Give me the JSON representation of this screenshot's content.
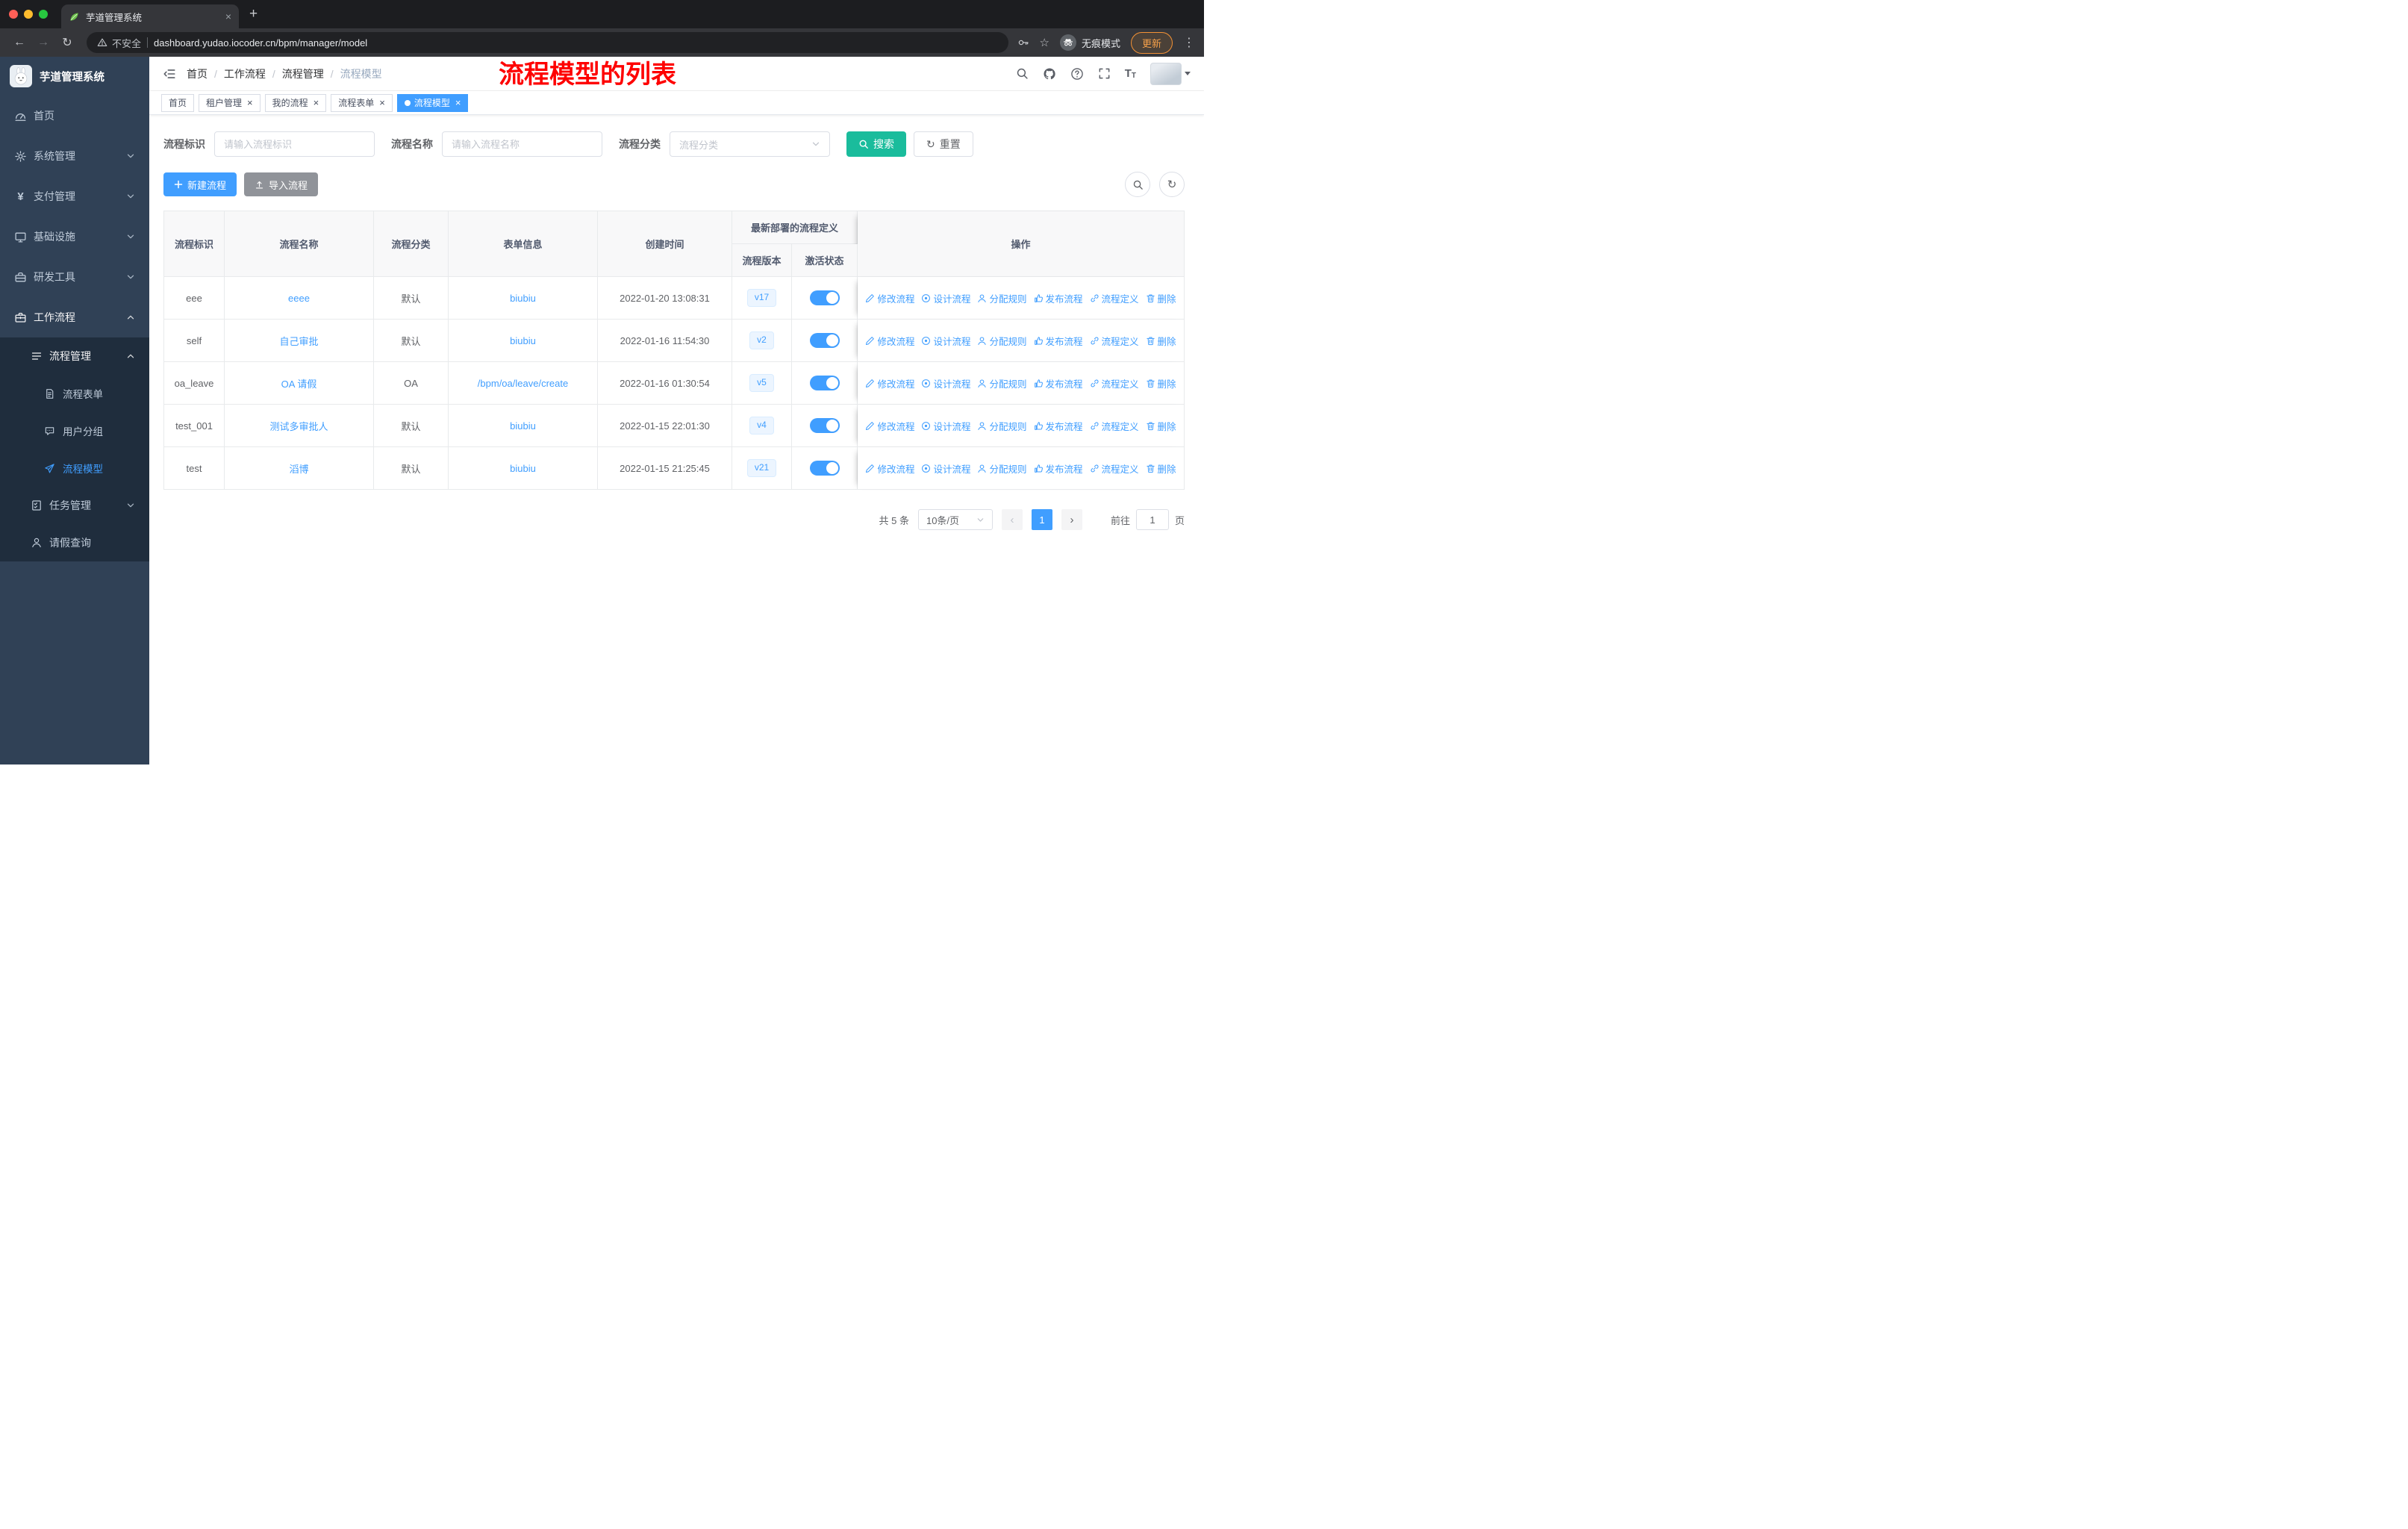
{
  "browser": {
    "tab_title": "芋道管理系统",
    "security_label": "不安全",
    "url": "dashboard.yudao.iocoder.cn/bpm/manager/model",
    "incognito_label": "无痕模式",
    "update_label": "更新"
  },
  "glyphs": {
    "close": "×",
    "new_tab": "+",
    "back": "←",
    "forward": "→",
    "reload": "↻",
    "star": "☆",
    "dots": "⋮",
    "prev": "‹",
    "next": "›",
    "refresh": "↻",
    "font_big": "T",
    "font_small": "T",
    "yen": "¥"
  },
  "sidebar": {
    "logo_title": "芋道管理系统",
    "menu": [
      {
        "label": "首页",
        "icon": "dashboard-icon"
      },
      {
        "label": "系统管理",
        "icon": "gear-icon"
      },
      {
        "label": "支付管理",
        "icon": "yen-icon"
      },
      {
        "label": "基础设施",
        "icon": "monitor-icon"
      },
      {
        "label": "研发工具",
        "icon": "toolbox-icon"
      },
      {
        "label": "工作流程",
        "icon": "briefcase-icon"
      },
      {
        "label": "流程管理",
        "icon": "list-icon"
      },
      {
        "label": "流程表单",
        "icon": "document-icon"
      },
      {
        "label": "用户分组",
        "icon": "chat-icon"
      },
      {
        "label": "流程模型",
        "icon": "paper-plane-icon"
      },
      {
        "label": "任务管理",
        "icon": "checklist-icon"
      },
      {
        "label": "请假查询",
        "icon": "user-icon"
      }
    ]
  },
  "navbar": {
    "breadcrumb": [
      "首页",
      "工作流程",
      "流程管理",
      "流程模型"
    ],
    "separator": "/"
  },
  "annotation": {
    "text": "流程模型的列表",
    "color": "#FE0000"
  },
  "tags": [
    {
      "label": "首页",
      "closable": false,
      "active": false
    },
    {
      "label": "租户管理",
      "closable": true,
      "active": false
    },
    {
      "label": "我的流程",
      "closable": true,
      "active": false
    },
    {
      "label": "流程表单",
      "closable": true,
      "active": false
    },
    {
      "label": "流程模型",
      "closable": true,
      "active": true
    }
  ],
  "filters": {
    "key_label": "流程标识",
    "key_placeholder": "请输入流程标识",
    "name_label": "流程名称",
    "name_placeholder": "请输入流程名称",
    "category_label": "流程分类",
    "category_placeholder": "流程分类",
    "search_label": "搜索",
    "reset_label": "重置"
  },
  "toolbar": {
    "create_label": "新建流程",
    "import_label": "导入流程"
  },
  "table": {
    "columns": [
      "流程标识",
      "流程名称",
      "流程分类",
      "表单信息",
      "创建时间",
      "流程版本",
      "激活状态",
      "操作"
    ],
    "group_header": "最新部署的流程定义",
    "row_actions": [
      {
        "icon": "edit-icon",
        "label": "修改流程"
      },
      {
        "icon": "design-icon",
        "label": "设计流程"
      },
      {
        "icon": "assign-icon",
        "label": "分配规则"
      },
      {
        "icon": "publish-icon",
        "label": "发布流程"
      },
      {
        "icon": "definition-icon",
        "label": "流程定义"
      },
      {
        "icon": "delete-icon",
        "label": "删除"
      }
    ],
    "rows": [
      {
        "key": "eee",
        "name": "eeee",
        "category": "默认",
        "form": "biubiu",
        "created": "2022-01-20 13:08:31",
        "version": "v17",
        "active": true
      },
      {
        "key": "self",
        "name": "自己审批",
        "category": "默认",
        "form": "biubiu",
        "created": "2022-01-16 11:54:30",
        "version": "v2",
        "active": true
      },
      {
        "key": "oa_leave",
        "name": "OA 请假",
        "category": "OA",
        "form": "/bpm/oa/leave/create",
        "created": "2022-01-16 01:30:54",
        "version": "v5",
        "active": true
      },
      {
        "key": "test_001",
        "name": "测试多审批人",
        "category": "默认",
        "form": "biubiu",
        "created": "2022-01-15 22:01:30",
        "version": "v4",
        "active": true
      },
      {
        "key": "test",
        "name": "滔博",
        "category": "默认",
        "form": "biubiu",
        "created": "2022-01-15 21:25:45",
        "version": "v21",
        "active": true
      }
    ]
  },
  "pagination": {
    "total_label": "共 5 条",
    "page_size": "10条/页",
    "page": "1",
    "goto_label": "前往",
    "page_unit": "页",
    "goto_value": "1"
  },
  "colors": {
    "primary": "#409EFF",
    "search_button": "#1ABC9C",
    "import_button": "#909399",
    "annotation": "#FE0000",
    "sidebar_bg": "#304156",
    "submenu_bg": "#1F2D3D",
    "active_tag": "#409EFF",
    "toggle_on": "#409EFF",
    "update_button": "#F29135"
  }
}
